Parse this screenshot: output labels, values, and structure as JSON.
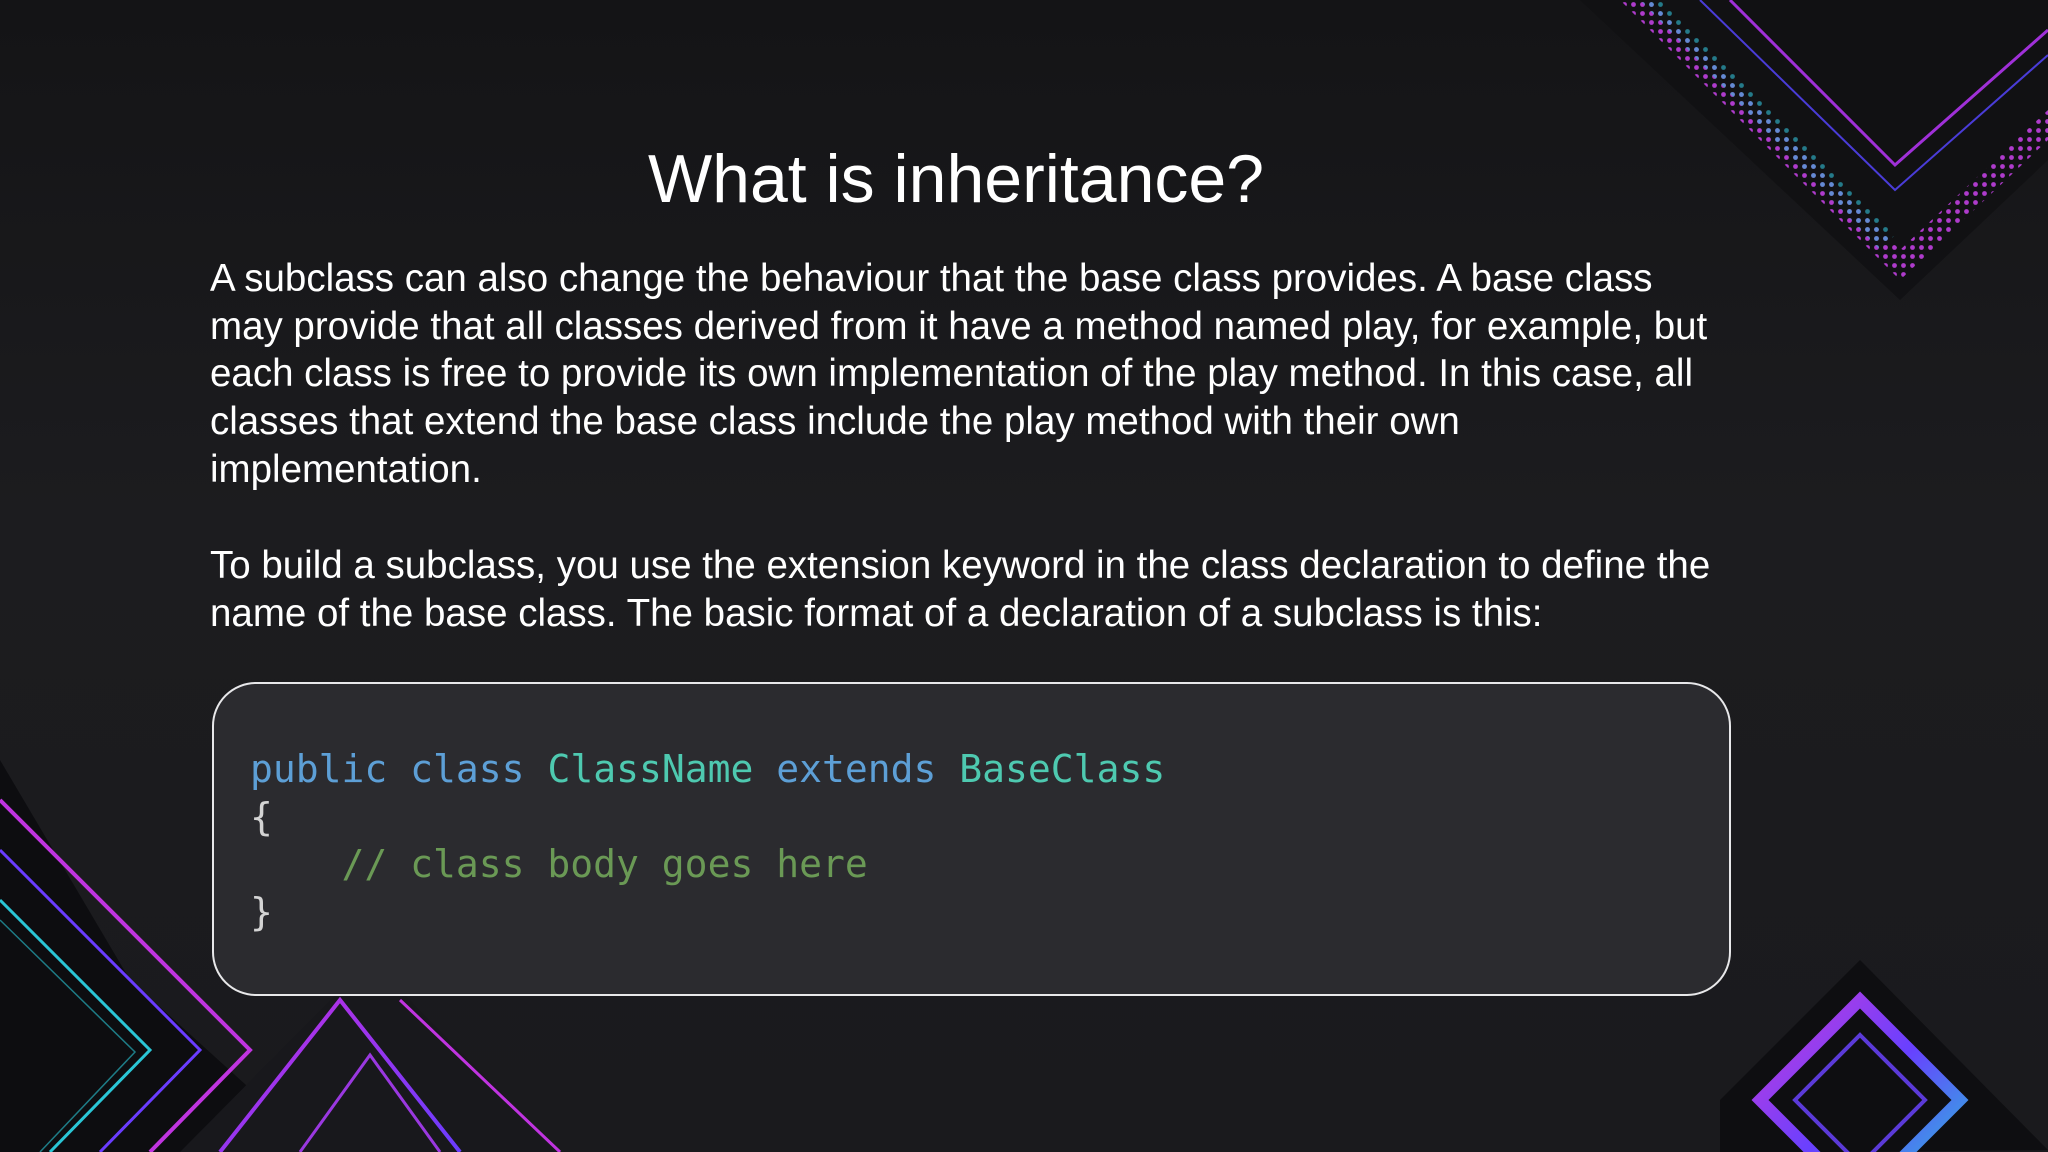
{
  "slide": {
    "title": "What is inheritance?",
    "paragraphs": [
      "A subclass can also change the behaviour that the base class provides. A base class may provide that all classes derived from it have a method named play, for example, but each class is free to provide its own implementation of the play method. In this case, all classes that extend the base class include the play method with their own implementation.",
      "To build a subclass, you use the extension keyword in the class declaration to define the name of the base class. The basic format of a declaration of a subclass is this:"
    ],
    "code": {
      "line1": {
        "kw1": "public",
        "kw2": "class",
        "class_name": "ClassName",
        "kw3": "extends",
        "base_class": "BaseClass"
      },
      "open_brace": "{",
      "comment": "// class body goes here",
      "close_brace": "}"
    }
  },
  "colors": {
    "background": "#1a1a1d",
    "title_text": "#ffffff",
    "body_text": "#ffffff",
    "code_box_bg": "#2b2b2f",
    "code_box_border": "#e8e8ea",
    "code_keyword": "#5d9fd6",
    "code_type": "#4ec9b0",
    "code_comment": "#6a9955",
    "code_punctuation": "#d4d4d4",
    "accent_cyan": "#28c8d8",
    "accent_purple": "#7a3cff",
    "accent_magenta": "#d030e0"
  }
}
